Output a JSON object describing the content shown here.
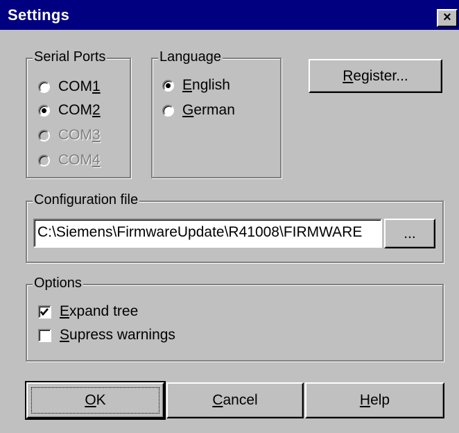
{
  "window": {
    "title": "Settings",
    "close_glyph": "×"
  },
  "serial_ports": {
    "legend": "Serial Ports",
    "options": [
      {
        "pre": "COM",
        "accel": "1",
        "post": "",
        "selected": false,
        "enabled": true
      },
      {
        "pre": "COM",
        "accel": "2",
        "post": "",
        "selected": true,
        "enabled": true
      },
      {
        "pre": "COM",
        "accel": "3",
        "post": "",
        "selected": false,
        "enabled": false
      },
      {
        "pre": "COM",
        "accel": "4",
        "post": "",
        "selected": false,
        "enabled": false
      }
    ]
  },
  "language": {
    "legend": "Language",
    "options": [
      {
        "pre": "",
        "accel": "E",
        "post": "nglish",
        "selected": true
      },
      {
        "pre": "",
        "accel": "G",
        "post": "erman",
        "selected": false
      }
    ]
  },
  "register_button": {
    "pre": "",
    "accel": "R",
    "post": "egister..."
  },
  "config": {
    "legend": "Configuration file",
    "path": "C:\\Siemens\\FirmwareUpdate\\R41008\\FIRMWARE",
    "browse_label": "..."
  },
  "options": {
    "legend": "Options",
    "items": [
      {
        "pre": "",
        "accel": "E",
        "post": "xpand tree",
        "checked": true
      },
      {
        "pre": "",
        "accel": "S",
        "post": "upress warnings",
        "checked": false
      }
    ]
  },
  "buttons": {
    "ok": {
      "pre": "",
      "accel": "O",
      "post": "K"
    },
    "cancel": {
      "pre": "",
      "accel": "C",
      "post": "ancel"
    },
    "help": {
      "pre": "",
      "accel": "H",
      "post": "elp"
    }
  }
}
